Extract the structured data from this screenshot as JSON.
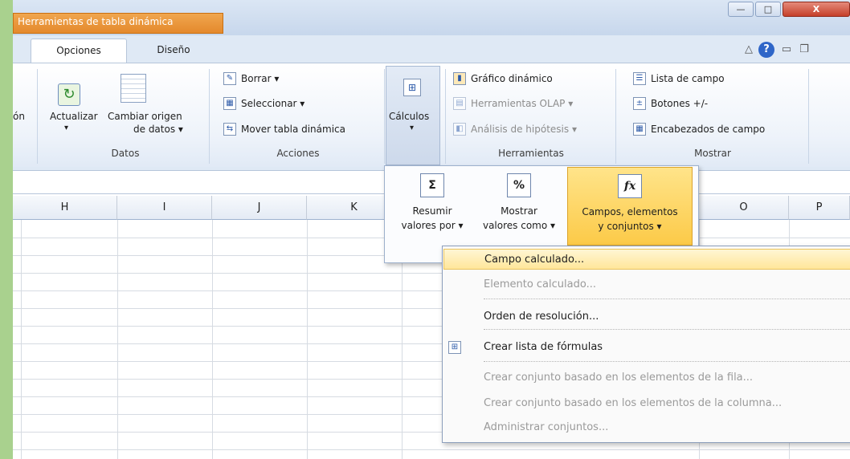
{
  "window": {
    "context_tab_group": "Herramientas de tabla dinámica",
    "controls": {
      "minimize": "—",
      "maximize": "□",
      "close": "X"
    }
  },
  "tabs": [
    {
      "label": "Opciones",
      "active": true
    },
    {
      "label": "Diseño",
      "active": false
    }
  ],
  "tab_right_icons": {
    "caret": "△",
    "help": "?",
    "minimize": "▭",
    "restore": "❐"
  },
  "ribbon": {
    "cut_label": "ón",
    "datos": {
      "label": "Datos",
      "actualizar": "Actualizar",
      "cambiar_origen_1": "Cambiar origen",
      "cambiar_origen_2": "de datos ▾"
    },
    "acciones": {
      "label": "Acciones",
      "borrar": "Borrar ▾",
      "seleccionar": "Seleccionar ▾",
      "mover": "Mover tabla dinámica"
    },
    "calculos": {
      "label": "Cálculos",
      "caret": "▾"
    },
    "herramientas": {
      "label": "Herramientas",
      "grafico": "Gráfico dinámico",
      "olap": "Herramientas OLAP ▾",
      "hipotesis": "Análisis de hipótesis ▾"
    },
    "mostrar": {
      "label": "Mostrar",
      "lista": "Lista de campo",
      "botones": "Botones +/-",
      "encabezados": "Encabezados de campo"
    }
  },
  "columns": [
    "H",
    "I",
    "J",
    "K",
    "O",
    "P"
  ],
  "calc_gallery": {
    "resumir_1": "Resumir",
    "resumir_2": "valores por ▾",
    "resumir_icon": "Σ",
    "mostrar_1": "Mostrar",
    "mostrar_2": "valores como ▾",
    "mostrar_icon": "%",
    "campos_1": "Campos, elementos",
    "campos_2": "y conjuntos ▾",
    "campos_icon": "fx"
  },
  "menu": [
    {
      "label": "Campo calculado...",
      "enabled": true
    },
    {
      "label": "Elemento calculado...",
      "enabled": false
    },
    {
      "label": "Orden de resolución...",
      "enabled": true
    },
    {
      "label": "Crear lista de fórmulas",
      "enabled": true
    },
    {
      "label": "Crear conjunto basado en los elementos de la fila...",
      "enabled": false
    },
    {
      "label": "Crear conjunto basado en los elementos de la columna...",
      "enabled": false
    },
    {
      "label": "Administrar conjuntos...",
      "enabled": false
    }
  ],
  "colors": {
    "accent_orange": "#e4892c",
    "highlight": "#fcca48",
    "frame_green": "#a9d18e"
  }
}
